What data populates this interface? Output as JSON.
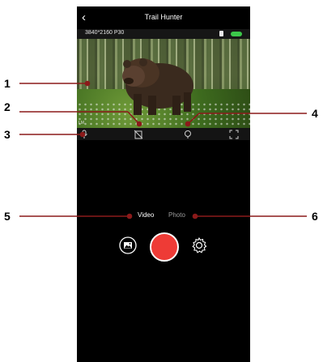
{
  "app": {
    "title": "Trail Hunter",
    "back_icon": "chevron-left-icon"
  },
  "status": {
    "resolution": "3840*2160 P30",
    "sd_card_icon": "sd-card-icon",
    "battery_icon": "battery-icon",
    "battery_color": "#3cc84a"
  },
  "preview": {
    "overlay_text": "LM"
  },
  "controls": {
    "microphone_icon": "microphone-icon",
    "no_sd_icon": "sd-card-off-icon",
    "flashlight_icon": "flashlight-icon",
    "fullscreen_icon": "expand-icon"
  },
  "modes": {
    "video": "Video",
    "photo": "Photo",
    "active": "Video"
  },
  "actions": {
    "gallery_icon": "gallery-icon",
    "shutter_color": "#ee3b36",
    "settings_icon": "gear-icon"
  },
  "callouts": [
    "1",
    "2",
    "3",
    "4",
    "5",
    "6"
  ]
}
